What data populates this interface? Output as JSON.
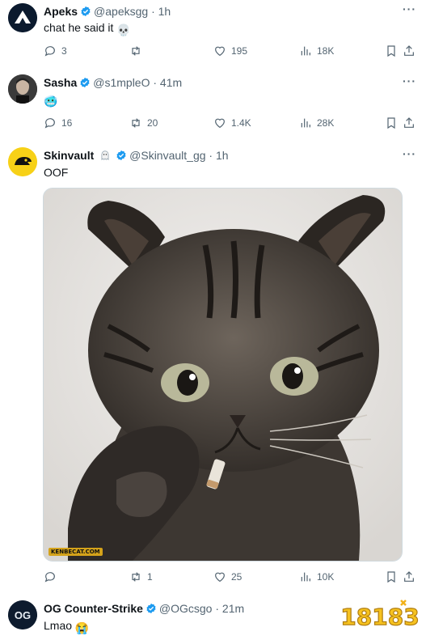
{
  "tweets": [
    {
      "name": "Apeks",
      "handle": "@apeksgg",
      "time": "· 1h",
      "text": "chat he said it",
      "emoji": "💀",
      "replies": "3",
      "retweets": "",
      "likes": "195",
      "views": "18K"
    },
    {
      "name": "Sasha",
      "handle": "@s1mpleO",
      "time": "· 41m",
      "text": "",
      "emoji": "🥶",
      "replies": "16",
      "retweets": "20",
      "likes": "1.4K",
      "views": "28K"
    },
    {
      "name": "Skinvault",
      "handle": "@Skinvault_gg",
      "time": "· 1h",
      "text": "OOF",
      "emoji": "",
      "replies": "",
      "retweets": "1",
      "likes": "25",
      "views": "10K",
      "media_credit": "KENBECAT.COM"
    },
    {
      "name": "OG Counter-Strike",
      "handle": "@OGcsgo",
      "time": "· 21m",
      "text": "Lmao",
      "emoji": "😭"
    }
  ],
  "more_label": "···",
  "watermark": "18183",
  "colors": {
    "verified": "#1d9bf0",
    "muted": "#536471",
    "text": "#0f1419",
    "divider": "#eff3f4"
  }
}
